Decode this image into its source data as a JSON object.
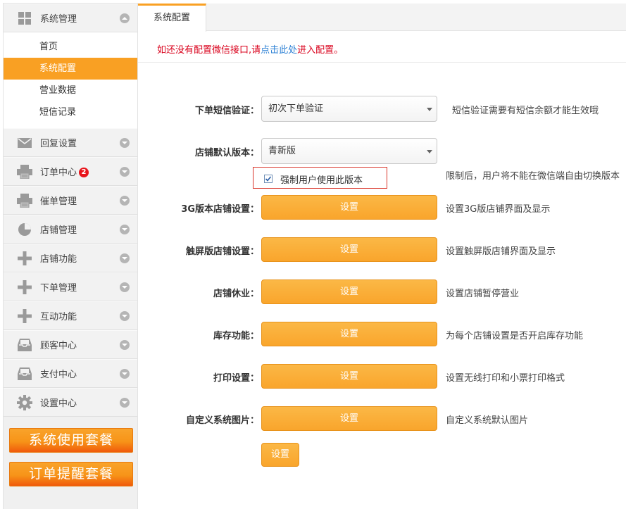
{
  "sidebar": {
    "system": {
      "label": "系统管理",
      "icon": "grid-icon"
    },
    "sub_items": [
      "首页",
      "系统配置",
      "营业数据",
      "短信记录"
    ],
    "menus": [
      {
        "label": "回复设置",
        "icon": "mail-icon"
      },
      {
        "label": "订单中心",
        "icon": "printer-icon",
        "badge": "2"
      },
      {
        "label": "催单管理",
        "icon": "printer-icon"
      },
      {
        "label": "店铺管理",
        "icon": "pie-chart-icon"
      },
      {
        "label": "店铺功能",
        "icon": "plus-icon"
      },
      {
        "label": "下单管理",
        "icon": "plus-icon"
      },
      {
        "label": "互动功能",
        "icon": "plus-icon"
      },
      {
        "label": "顾客中心",
        "icon": "inbox-icon"
      },
      {
        "label": "支付中心",
        "icon": "inbox-icon"
      },
      {
        "label": "设置中心",
        "icon": "gear-icon"
      }
    ],
    "package_buttons": [
      "系统使用套餐",
      "订单提醒套餐"
    ]
  },
  "tabs": {
    "active": "系统配置"
  },
  "notice": {
    "before": "如还没有配置微信接口,请",
    "link": "点击此处",
    "after": "进入配置。"
  },
  "form": {
    "sms": {
      "label": "下单短信验证：",
      "value": "初次下单验证",
      "hint": "短信验证需要有短信余额才能生效哦"
    },
    "version": {
      "label": "店铺默认版本：",
      "value": "青新版"
    },
    "force": {
      "label": "强制用户使用此版本",
      "checked": true,
      "hint": "限制后，用户将不能在微信端自由切换版本"
    },
    "settings": [
      {
        "label": "3G版本店铺设置：",
        "button": "设置",
        "hint": "设置3G版店铺界面及显示"
      },
      {
        "label": "触屏版店铺设置：",
        "button": "设置",
        "hint": "设置触屏版店铺界面及显示"
      },
      {
        "label": "店铺休业：",
        "button": "设置",
        "hint": "设置店铺暂停营业"
      },
      {
        "label": "库存功能：",
        "button": "设置",
        "hint": "为每个店铺设置是否开启库存功能"
      },
      {
        "label": "打印设置：",
        "button": "设置",
        "hint": "设置无线打印和小票打印格式"
      },
      {
        "label": "自定义系统图片：",
        "button": "设置",
        "hint": "自定义系统默认图片"
      }
    ],
    "submit": "设置"
  },
  "colors": {
    "accent": "#f9a023",
    "notice": "#d9001b",
    "link": "#2a7fd4",
    "badge": "#e8141b"
  }
}
